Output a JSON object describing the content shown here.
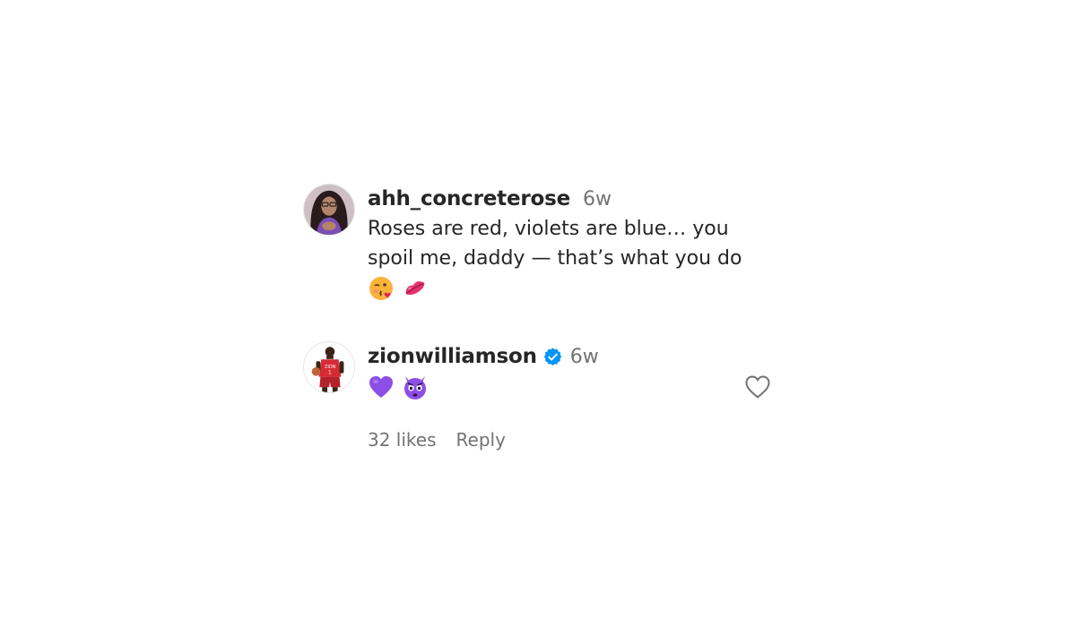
{
  "comments": [
    {
      "username": "ahh_concreterose",
      "time": "6w",
      "text": "Roses are red, violets are blue… you spoil me, daddy — that’s what you do",
      "emojis": [
        "kissing-face-with-heart-emoji",
        "lips-kiss-mark-emoji"
      ],
      "avatar": "profile-photo-avatar"
    },
    {
      "username": "zionwilliamson",
      "verified": true,
      "time": "6w",
      "emojis": [
        "purple-heart-emoji",
        "purple-devil-face-emoji"
      ],
      "likes_label": "32 likes",
      "reply_label": "Reply",
      "avatar": "basketball-player-avatar",
      "like_icon": "heart-outline-icon"
    }
  ],
  "colors": {
    "verified_badge": "#0095f6",
    "secondary_text": "#737373",
    "primary_text": "#262626"
  }
}
